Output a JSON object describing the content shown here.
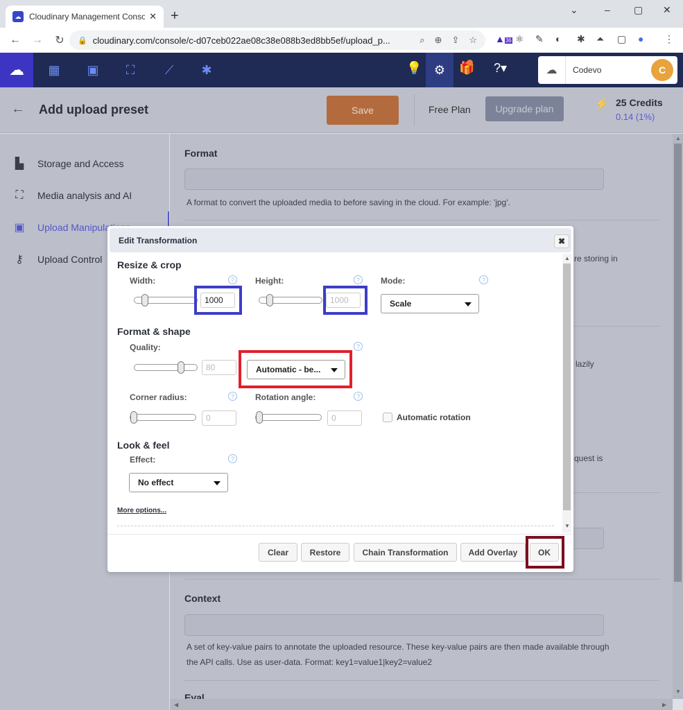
{
  "browser": {
    "tab_title": "Cloudinary Management Console",
    "tab_close": "✕",
    "new_tab": "+",
    "window_controls": [
      "⌄",
      "–",
      "▢",
      "✕"
    ],
    "url": "cloudinary.com/console/c-d07ceb022ae08c38e088b3ed8bb5ef/upload_p...",
    "extension_badge": "36"
  },
  "appbar": {
    "nav_icons": [
      "dashboard-icon",
      "media-library-icon",
      "transformations-icon",
      "reports-icon",
      "addons-icon"
    ],
    "account_name": "Codevo",
    "avatar_initial": "C"
  },
  "header": {
    "back": "←",
    "title": "Add upload preset",
    "save_label": "Save",
    "plan_label": "Free Plan",
    "upgrade_label": "Upgrade plan",
    "credits": "25 Credits",
    "credits_used": "0.14 (1%)"
  },
  "sidebar": {
    "items": [
      {
        "label": "Storage and Access",
        "icon": "storage-icon",
        "active": false
      },
      {
        "label": "Media analysis and AI",
        "icon": "media-analysis-icon",
        "active": false
      },
      {
        "label": "Upload Manipulations",
        "icon": "upload-manipulation-icon",
        "active": true
      },
      {
        "label": "Upload Control",
        "icon": "key-icon",
        "active": false
      }
    ]
  },
  "main": {
    "format": {
      "title": "Format",
      "value": "",
      "help": "A format to convert the uploaded media to before saving in the cloud. For example: 'jpg'."
    },
    "peek_texts": [
      "re storing in",
      "lazily",
      "quest is"
    ],
    "context": {
      "title": "Context",
      "value": "",
      "help": "A set of key-value pairs to annotate the uploaded resource. These key-value pairs are then made available through the API calls. Use as user-data. Format: key1=value1|key2=value2"
    },
    "next_title": "Eval"
  },
  "modal": {
    "title": "Edit Transformation",
    "close": "✖",
    "resize": {
      "section": "Resize & crop",
      "width_label": "Width:",
      "width_value": "1000",
      "height_label": "Height:",
      "height_value": "1000",
      "mode_label": "Mode:",
      "mode_value": "Scale"
    },
    "format_shape": {
      "section": "Format & shape",
      "quality_label": "Quality:",
      "quality_value": "80",
      "quality_select": "Automatic - be...",
      "corner_label": "Corner radius:",
      "corner_value": "0",
      "rotation_label": "Rotation angle:",
      "rotation_value": "0",
      "auto_rotation_label": "Automatic rotation",
      "auto_rotation_checked": false
    },
    "look_feel": {
      "section": "Look & feel",
      "effect_label": "Effect:",
      "effect_value": "No effect"
    },
    "more_options": "More options...",
    "help_glyph": "?",
    "buttons": {
      "clear": "Clear",
      "restore": "Restore",
      "chain": "Chain Transformation",
      "overlay": "Add Overlay",
      "ok": "OK"
    }
  },
  "highlights": {
    "blue": "#3e3ec8",
    "red": "#e2202c",
    "darkred": "#7a0f1f"
  }
}
